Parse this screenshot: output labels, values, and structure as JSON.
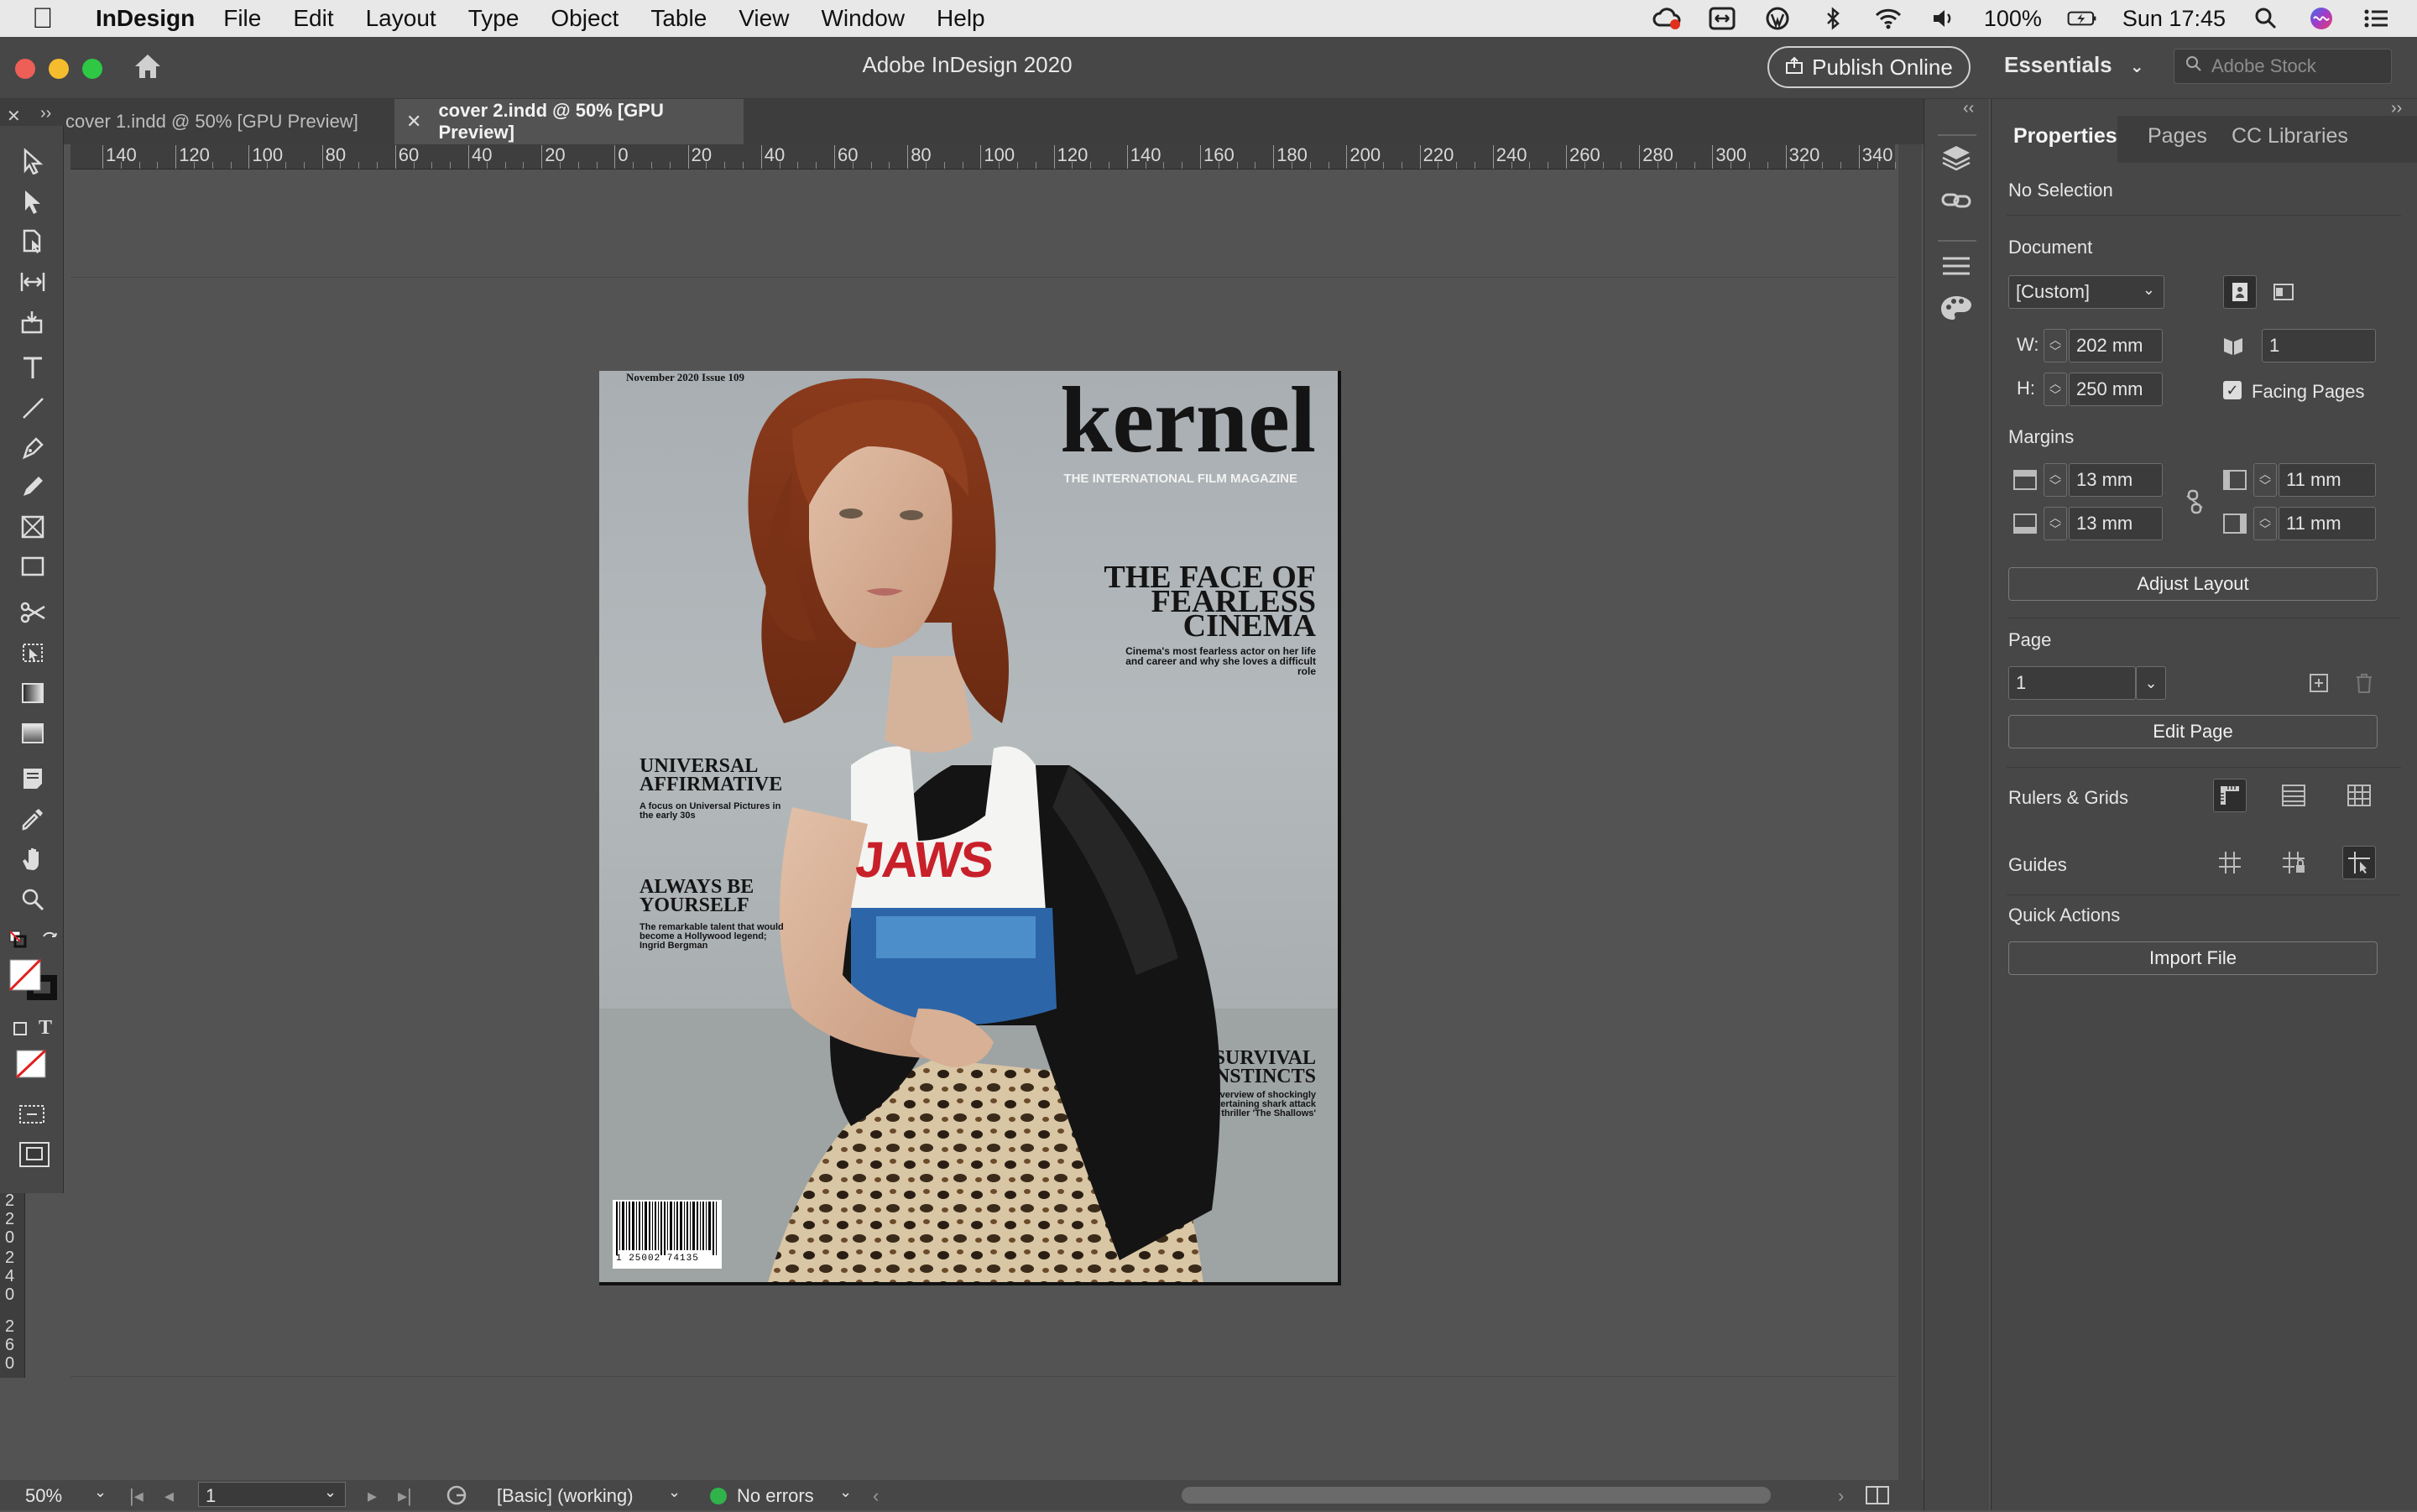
{
  "menubar": {
    "app_name": "InDesign",
    "items": [
      "File",
      "Edit",
      "Layout",
      "Type",
      "Object",
      "Table",
      "View",
      "Window",
      "Help"
    ],
    "battery": "100%",
    "clock": "Sun 17:45"
  },
  "window": {
    "title": "Adobe InDesign 2020",
    "publish_label": "Publish Online",
    "workspace_label": "Essentials",
    "search_placeholder": "Adobe Stock"
  },
  "tabs": [
    {
      "label": "cover 1.indd @ 50% [GPU Preview]"
    },
    {
      "label": "cover 2.indd @ 50% [GPU Preview]",
      "active": true
    }
  ],
  "ruler": {
    "h_labels": [
      "140",
      "120",
      "100",
      "80",
      "60",
      "40",
      "20",
      "0",
      "20",
      "40",
      "60",
      "80",
      "100",
      "120",
      "140",
      "160",
      "180",
      "200",
      "220",
      "240",
      "260",
      "280",
      "300",
      "320",
      "340"
    ],
    "v_labels": [
      [
        "2",
        "2",
        "0"
      ],
      [
        "2",
        "4",
        "0"
      ],
      [
        "2",
        "6",
        "0"
      ]
    ]
  },
  "cover": {
    "issue_line": "November 2020 Issue 109",
    "masthead": "kernel",
    "tagline": "THE INTERNATIONAL FILM MAGAZINE",
    "headline_1": [
      "THE FACE OF",
      "FEARLESS",
      "CINEMA"
    ],
    "sub_1": "Cinema's most fearless actor on her life and career and why she loves a difficult role",
    "headline_2": [
      "UNIVERSAL",
      "AFFIRMATIVE"
    ],
    "sub_2": "A focus on Universal Pictures in the early 30s",
    "headline_3": [
      "ALWAYS BE",
      "YOURSELF"
    ],
    "sub_3": "The remarkable talent that would become a Hollywood legend; Ingrid Bergman",
    "headline_4": [
      "SURVIVAL",
      "INSTINCTS"
    ],
    "sub_4": "Overview of shockingly entertaining shark attack thriller 'The Shallows'",
    "shirt_text": "JAWS",
    "barcode_number": "1 25002 74135"
  },
  "statusbar": {
    "zoom": "50%",
    "page": "1",
    "preflight_profile": "[Basic] (working)",
    "errors": "No errors",
    "status_color": "#2fb34a"
  },
  "properties": {
    "tabs": [
      "Properties",
      "Pages",
      "CC Libraries"
    ],
    "selection": "No Selection",
    "document_label": "Document",
    "preset": "[Custom]",
    "w_label": "W:",
    "width": "202 mm",
    "h_label": "H:",
    "height": "250 mm",
    "pages": "1",
    "facing_label": "Facing Pages",
    "margins_label": "Margins",
    "margin_top": "13 mm",
    "margin_bottom": "13 mm",
    "margin_left": "11 mm",
    "margin_right": "11 mm",
    "adjust_layout": "Adjust Layout",
    "page_label": "Page",
    "page_value": "1",
    "edit_page": "Edit Page",
    "rulers_label": "Rulers & Grids",
    "guides_label": "Guides",
    "quick_actions": "Quick Actions",
    "import_file": "Import File"
  }
}
